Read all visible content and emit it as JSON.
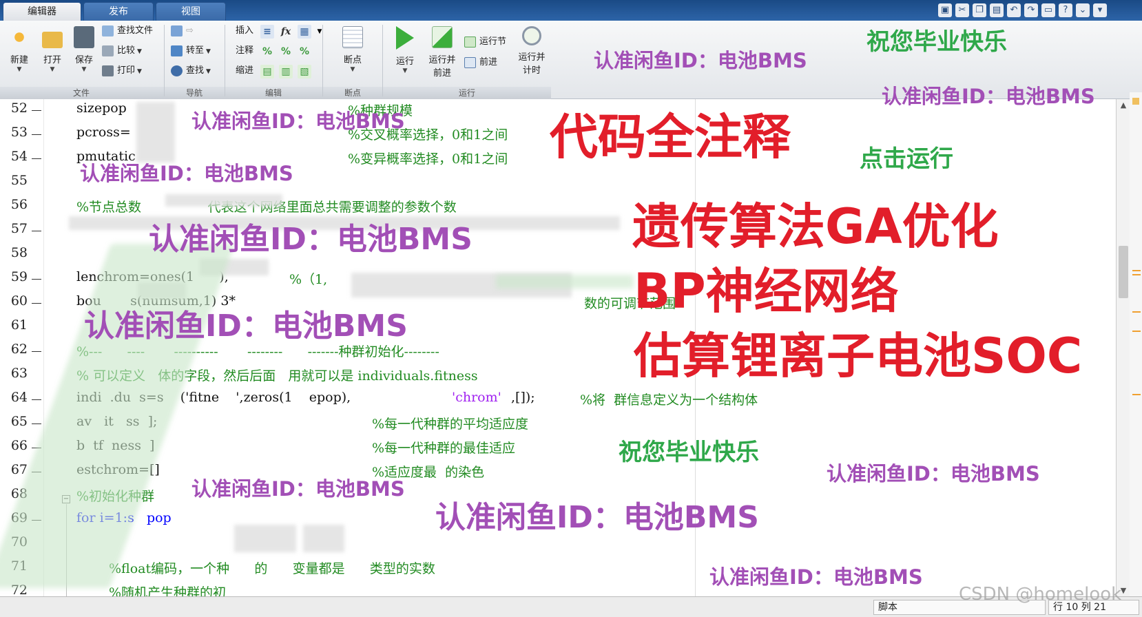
{
  "tabs": [
    {
      "label": "编辑器",
      "active": true
    },
    {
      "label": "发布",
      "active": false
    },
    {
      "label": "视图",
      "active": false
    }
  ],
  "ribbon": {
    "file": {
      "new": "新建",
      "open": "打开",
      "save": "保存",
      "find_files": "查找文件",
      "compare": "比较",
      "print": "打印",
      "section": "文件"
    },
    "navigate": {
      "goto": "转至",
      "find": "查找",
      "section": "导航"
    },
    "edit": {
      "insert": "插入",
      "comment": "注释",
      "indent": "缩进",
      "fx": "fx",
      "section": "编辑"
    },
    "breakpoints": {
      "breakpoint": "断点",
      "section": "断点"
    },
    "run": {
      "run": "运行",
      "run_advance_1": "运行并",
      "run_advance_2": "前进",
      "run_section": "运行节",
      "advance": "前进",
      "run_time_1": "运行并",
      "run_time_2": "计时",
      "section": "运行"
    }
  },
  "editor": {
    "lines": [
      {
        "n": "52",
        "dash": true,
        "code": "sizepop",
        "comment": "%种群规模"
      },
      {
        "n": "53",
        "dash": true,
        "code": "pcross=",
        "comment": "%交叉概率选择，0和1之间"
      },
      {
        "n": "54",
        "dash": true,
        "code": "pmutatic",
        "comment": "%变异概率选择，0和1之间"
      },
      {
        "n": "55",
        "dash": false,
        "code": "",
        "comment": ""
      },
      {
        "n": "56",
        "dash": false,
        "code": "",
        "comment": "%节点总数                代表这个网络里面总共需要调整的参数个数"
      },
      {
        "n": "57",
        "dash": true,
        "code": "",
        "comment": ""
      },
      {
        "n": "58",
        "dash": false,
        "code": "",
        "comment": ""
      },
      {
        "n": "59",
        "dash": true,
        "code": "lenchrom=ones(1      ),",
        "comment": "%（1,"
      },
      {
        "n": "60",
        "dash": true,
        "code": "bou       s(numsum,1) 3*",
        "comment": "数的可调节范围"
      },
      {
        "n": "61",
        "dash": false,
        "code": "",
        "comment": ""
      },
      {
        "n": "62",
        "dash": true,
        "code": "",
        "comment": "%---      ----       ----------       --------      -------种群初始化--------"
      },
      {
        "n": "63",
        "dash": false,
        "code": "",
        "comment": "% 可以定义   体的字段，然后后面   用就可以是 individuals.fitness"
      },
      {
        "n": "64",
        "dash": true,
        "code": "indi  .du  s=s    ('fitne    ',zeros(1    epop),",
        "str": "'chrom'",
        "code2": ",[]);",
        "comment": "%将  群信息定义为一个结构体"
      },
      {
        "n": "65",
        "dash": true,
        "code": "av   it   ss  ];",
        "comment": "%每一代种群的平均适应度"
      },
      {
        "n": "66",
        "dash": true,
        "code": "b  tf  ness  ]",
        "comment": "%每一代种群的最佳适应"
      },
      {
        "n": "67",
        "dash": true,
        "code": "estchrom=[]",
        "comment": "%适应度最  的染色"
      },
      {
        "n": "68",
        "dash": false,
        "code": "",
        "comment": "%初始化种群"
      },
      {
        "n": "69",
        "dash": true,
        "code": "for i=1:s   pop",
        "comment": ""
      },
      {
        "n": "70",
        "dash": false,
        "code": "",
        "comment": ""
      },
      {
        "n": "71",
        "dash": false,
        "code": "",
        "comment": "%float编码，一个种      的      变量都是      类型的实数"
      },
      {
        "n": "72",
        "dash": false,
        "code": "",
        "comment": "%随机产生种群的初"
      }
    ]
  },
  "status": {
    "mode": "脚本",
    "position": "行 10  列 21"
  },
  "watermarks": {
    "seller": "认准闲鱼ID：电池BMS",
    "congrats": "祝您毕业快乐",
    "click_run": "点击运行",
    "headline_1": "代码全注释",
    "headline_2": "遗传算法GA优化",
    "headline_3": "BP神经网络",
    "headline_4": "估算锂离子电池SOC",
    "csdn": "CSDN @homelook"
  },
  "colors": {
    "watermark_purple": "#a24fb6",
    "watermark_green": "#2fa84a",
    "watermark_red": "#e21e2a",
    "comment_green": "#228b22"
  }
}
